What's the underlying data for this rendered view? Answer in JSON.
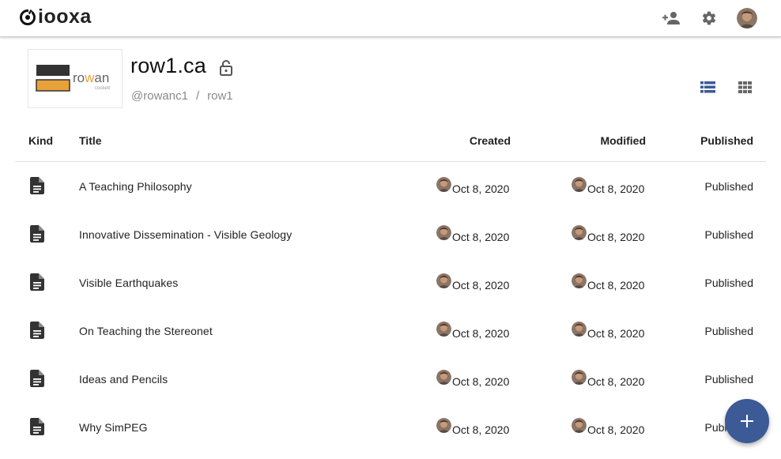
{
  "app": {
    "name": "iooxa"
  },
  "topbar": {
    "icons": [
      "add-person-icon",
      "gear-icon",
      "user-avatar"
    ]
  },
  "library": {
    "title": "row1.ca",
    "logo_text_top": "rowan",
    "logo_text_bottom": "cockett",
    "owner": "@rowanc1",
    "separator": "/",
    "slug": "row1",
    "visibility_icon": "lock-open-icon",
    "view_modes": [
      "list-view-icon",
      "grid-view-icon"
    ]
  },
  "table": {
    "headers": {
      "kind": "Kind",
      "title": "Title",
      "created": "Created",
      "modified": "Modified",
      "published": "Published"
    },
    "rows": [
      {
        "kind": "document-icon",
        "title": "A Teaching Philosophy",
        "created": "Oct 8, 2020",
        "modified": "Oct 8, 2020",
        "status": "Published"
      },
      {
        "kind": "document-icon",
        "title": "Innovative Dissemination - Visible Geology",
        "created": "Oct 8, 2020",
        "modified": "Oct 8, 2020",
        "status": "Published"
      },
      {
        "kind": "document-icon",
        "title": "Visible Earthquakes",
        "created": "Oct 8, 2020",
        "modified": "Oct 8, 2020",
        "status": "Published"
      },
      {
        "kind": "document-icon",
        "title": "On Teaching the Stereonet",
        "created": "Oct 8, 2020",
        "modified": "Oct 8, 2020",
        "status": "Published"
      },
      {
        "kind": "document-icon",
        "title": "Ideas and Pencils",
        "created": "Oct 8, 2020",
        "modified": "Oct 8, 2020",
        "status": "Published"
      },
      {
        "kind": "document-icon",
        "title": "Why SimPEG",
        "created": "Oct 8, 2020",
        "modified": "Oct 8, 2020",
        "status": "Published"
      }
    ]
  },
  "fab": {
    "icon": "plus-icon"
  },
  "colors": {
    "accent": "#3c5a96",
    "logo_orange": "#e8a23a",
    "logo_dark": "#333333",
    "muted_text": "#8a8a8a"
  }
}
